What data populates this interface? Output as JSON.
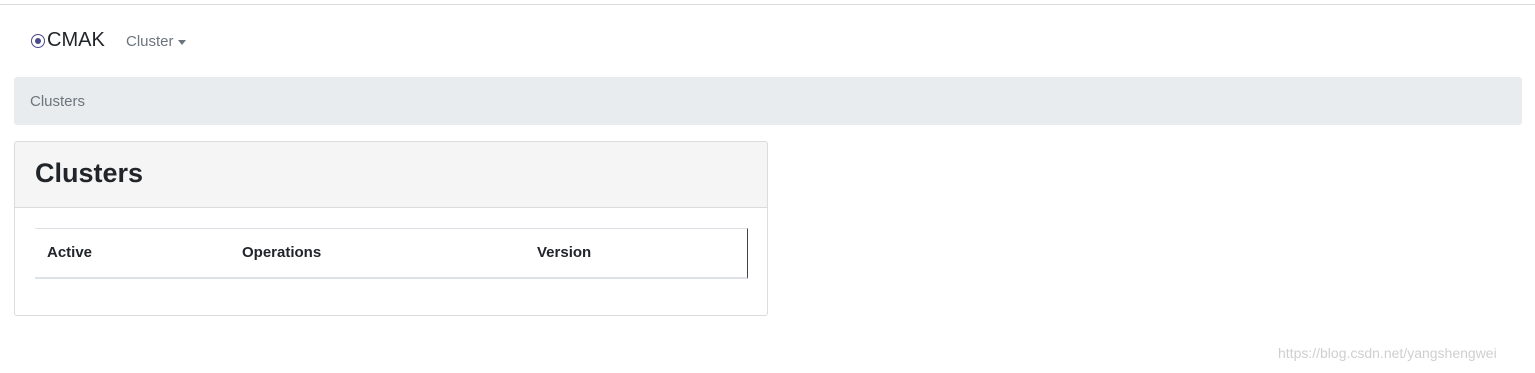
{
  "navbar": {
    "brand": "CMAK",
    "brand_icon": "cmak-logo-icon",
    "cluster_menu_label": "Cluster"
  },
  "breadcrumb": {
    "items": [
      "Clusters"
    ]
  },
  "card": {
    "title": "Clusters",
    "table": {
      "columns": [
        "Active",
        "Operations",
        "Version"
      ],
      "rows": []
    }
  },
  "watermark": "https://blog.csdn.net/yangshengwei",
  "colors": {
    "breadcrumb_bg": "#e9ecef",
    "card_header_bg": "#f5f5f5",
    "muted_text": "#6c757d",
    "logo": "#4a4a8a"
  }
}
